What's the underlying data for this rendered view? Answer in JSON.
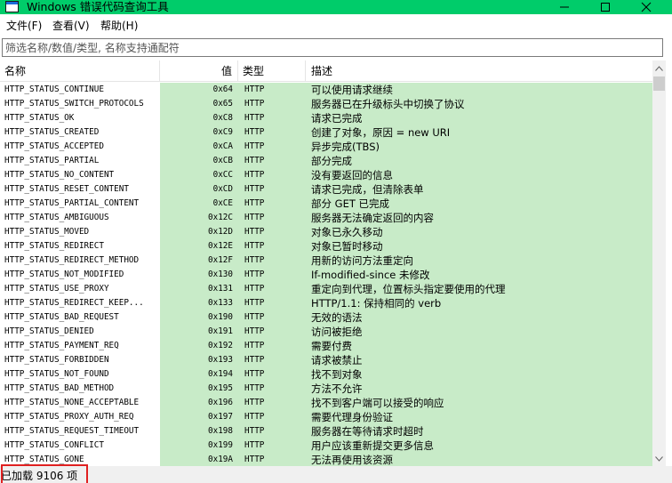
{
  "window": {
    "title": "Windows 错误代码查询工具",
    "accent": "#00cc6a"
  },
  "menu": [
    "文件(F)",
    "查看(V)",
    "帮助(H)"
  ],
  "filter": {
    "placeholder": "筛选名称/数值/类型, 名称支持通配符",
    "value": ""
  },
  "columns": [
    "名称",
    "值",
    "类型",
    "描述"
  ],
  "rows": [
    {
      "name": "HTTP_STATUS_CONTINUE",
      "value": "0x64",
      "type": "HTTP",
      "desc": "可以使用请求继续"
    },
    {
      "name": "HTTP_STATUS_SWITCH_PROTOCOLS",
      "value": "0x65",
      "type": "HTTP",
      "desc": "服务器已在升级标头中切换了协议"
    },
    {
      "name": "HTTP_STATUS_OK",
      "value": "0xC8",
      "type": "HTTP",
      "desc": "请求已完成"
    },
    {
      "name": "HTTP_STATUS_CREATED",
      "value": "0xC9",
      "type": "HTTP",
      "desc": "创建了对象，原因 = new URI"
    },
    {
      "name": "HTTP_STATUS_ACCEPTED",
      "value": "0xCA",
      "type": "HTTP",
      "desc": "异步完成(TBS)"
    },
    {
      "name": "HTTP_STATUS_PARTIAL",
      "value": "0xCB",
      "type": "HTTP",
      "desc": "部分完成"
    },
    {
      "name": "HTTP_STATUS_NO_CONTENT",
      "value": "0xCC",
      "type": "HTTP",
      "desc": "没有要返回的信息"
    },
    {
      "name": "HTTP_STATUS_RESET_CONTENT",
      "value": "0xCD",
      "type": "HTTP",
      "desc": "请求已完成，但清除表单"
    },
    {
      "name": "HTTP_STATUS_PARTIAL_CONTENT",
      "value": "0xCE",
      "type": "HTTP",
      "desc": "部分 GET 已完成"
    },
    {
      "name": "HTTP_STATUS_AMBIGUOUS",
      "value": "0x12C",
      "type": "HTTP",
      "desc": "服务器无法确定返回的内容"
    },
    {
      "name": "HTTP_STATUS_MOVED",
      "value": "0x12D",
      "type": "HTTP",
      "desc": "对象已永久移动"
    },
    {
      "name": "HTTP_STATUS_REDIRECT",
      "value": "0x12E",
      "type": "HTTP",
      "desc": "对象已暂时移动"
    },
    {
      "name": "HTTP_STATUS_REDIRECT_METHOD",
      "value": "0x12F",
      "type": "HTTP",
      "desc": "用新的访问方法重定向"
    },
    {
      "name": "HTTP_STATUS_NOT_MODIFIED",
      "value": "0x130",
      "type": "HTTP",
      "desc": "If-modified-since 未修改"
    },
    {
      "name": "HTTP_STATUS_USE_PROXY",
      "value": "0x131",
      "type": "HTTP",
      "desc": "重定向到代理，位置标头指定要使用的代理"
    },
    {
      "name": "HTTP_STATUS_REDIRECT_KEEP...",
      "value": "0x133",
      "type": "HTTP",
      "desc": "HTTP/1.1: 保持相同的 verb"
    },
    {
      "name": "HTTP_STATUS_BAD_REQUEST",
      "value": "0x190",
      "type": "HTTP",
      "desc": "无效的语法"
    },
    {
      "name": "HTTP_STATUS_DENIED",
      "value": "0x191",
      "type": "HTTP",
      "desc": "访问被拒绝"
    },
    {
      "name": "HTTP_STATUS_PAYMENT_REQ",
      "value": "0x192",
      "type": "HTTP",
      "desc": "需要付费"
    },
    {
      "name": "HTTP_STATUS_FORBIDDEN",
      "value": "0x193",
      "type": "HTTP",
      "desc": "请求被禁止"
    },
    {
      "name": "HTTP_STATUS_NOT_FOUND",
      "value": "0x194",
      "type": "HTTP",
      "desc": "找不到对象"
    },
    {
      "name": "HTTP_STATUS_BAD_METHOD",
      "value": "0x195",
      "type": "HTTP",
      "desc": "方法不允许"
    },
    {
      "name": "HTTP_STATUS_NONE_ACCEPTABLE",
      "value": "0x196",
      "type": "HTTP",
      "desc": "找不到客户端可以接受的响应"
    },
    {
      "name": "HTTP_STATUS_PROXY_AUTH_REQ",
      "value": "0x197",
      "type": "HTTP",
      "desc": "需要代理身份验证"
    },
    {
      "name": "HTTP_STATUS_REQUEST_TIMEOUT",
      "value": "0x198",
      "type": "HTTP",
      "desc": "服务器在等待请求时超时"
    },
    {
      "name": "HTTP_STATUS_CONFLICT",
      "value": "0x199",
      "type": "HTTP",
      "desc": "用户应该重新提交更多信息"
    },
    {
      "name": "HTTP_STATUS_GONE",
      "value": "0x19A",
      "type": "HTTP",
      "desc": "无法再使用该资源"
    }
  ],
  "status": {
    "text": "已加载 9106 项"
  },
  "icons": {
    "app": "app-window-icon",
    "minimize": "minimize-icon",
    "maximize": "maximize-icon",
    "close": "close-icon",
    "scroll_up": "scroll-up-arrow-icon",
    "scroll_down": "scroll-down-arrow-icon"
  },
  "colors": {
    "row_background": "#c8ebc8",
    "status_highlight": "#e02020"
  }
}
